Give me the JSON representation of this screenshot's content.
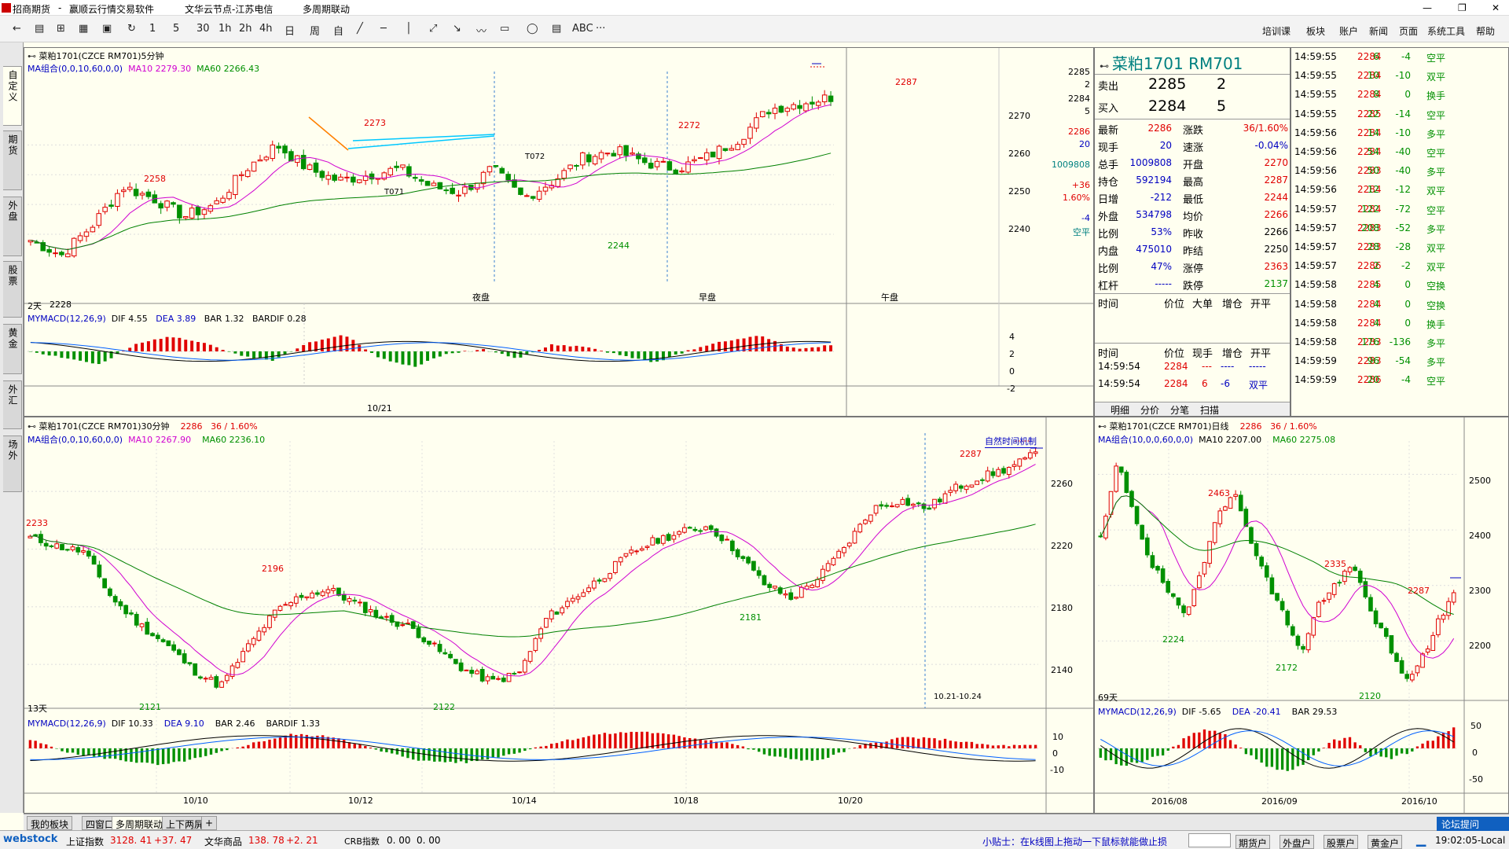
{
  "titlebar": {
    "app": "招商期货",
    "sep": "-",
    "product": "赢顺云行情交易软件",
    "server": "文华云节点-江苏电信",
    "mode": "多周期联动"
  },
  "toolbar": {
    "tools": [
      "←",
      "▤",
      "⊞",
      "▦",
      "▣",
      "↻",
      "1",
      "5",
      "30",
      "1h",
      "2h",
      "4h",
      "日",
      "周",
      "自",
      "╱",
      "─",
      "│",
      "⤢",
      "↘",
      "〰",
      "▭",
      "◯",
      "▤",
      "ABC",
      "···"
    ],
    "menus": [
      "培训课",
      "板块",
      "账户",
      "新闻",
      "页面",
      "系统工具",
      "帮助"
    ]
  },
  "left_tabs": [
    "自定义",
    "期货",
    "外盘",
    "股票",
    "黄金",
    "外汇",
    "场外"
  ],
  "chart5m": {
    "title": "菜粕1701(CZCE RM701)5分钟",
    "ma_label": "MA组合(0,0,10,60,0,0)",
    "ma10": "MA10 2279.30",
    "ma60": "MA60 2266.43",
    "macd_label": "MYMACD(12,26,9)",
    "dif": "DIF  4.55",
    "dea": "DEA  3.89",
    "bar": "BAR  1.32",
    "bardif": "BARDIF  0.28",
    "days": "2天",
    "low_label": "2228",
    "sessions": [
      "夜盘",
      "早盘",
      "午盘"
    ],
    "annotations": [
      "2273",
      "2272",
      "2258",
      "2244",
      "2287",
      "T071",
      "T072"
    ],
    "date": "10/21",
    "yticks": [
      "2270",
      "2260",
      "2250",
      "2240"
    ],
    "right_info": [
      "2285",
      "2",
      "2284",
      "5",
      "2286",
      "20",
      "1009808",
      "+36",
      "1.60%",
      "-4",
      "空平"
    ],
    "macd_ticks": [
      "4",
      "2",
      "0",
      "-2"
    ]
  },
  "quote": {
    "name": "菜粕1701  RM701",
    "sell_label": "卖出",
    "sell_price": "2285",
    "sell_vol": "2",
    "buy_label": "买入",
    "buy_price": "2284",
    "buy_vol": "5",
    "rows": [
      {
        "l": "最新",
        "v": "2286",
        "l2": "涨跌",
        "v2": "36/1.60%"
      },
      {
        "l": "现手",
        "v": "20",
        "l2": "速涨",
        "v2": "-0.04%"
      },
      {
        "l": "总手",
        "v": "1009808",
        "l2": "开盘",
        "v2": "2270"
      },
      {
        "l": "持仓",
        "v": "592194",
        "l2": "最高",
        "v2": "2287"
      },
      {
        "l": "日增",
        "v": "-212",
        "l2": "最低",
        "v2": "2244"
      },
      {
        "l": "外盘",
        "v": "534798",
        "l2": "均价",
        "v2": "2266"
      },
      {
        "l": "比例",
        "v": "53%",
        "l2": "昨收",
        "v2": "2266"
      },
      {
        "l": "内盘",
        "v": "475010",
        "l2": "昨结",
        "v2": "2250"
      },
      {
        "l": "比例",
        "v": "47%",
        "l2": "涨停",
        "v2": "2363"
      },
      {
        "l": "杠杆",
        "v": "-----",
        "l2": "跌停",
        "v2": "2137"
      }
    ],
    "tick_header": [
      "时间",
      "价位",
      "大单",
      "增仓",
      "开平"
    ],
    "tick_header2": [
      "时间",
      "价位",
      "现手",
      "增仓",
      "开平"
    ],
    "ticks_small": [
      {
        "t": "14:59:54",
        "p": "2284",
        "v": "---",
        "c": "----",
        "k": "-----"
      },
      {
        "t": "14:59:54",
        "p": "2284",
        "v": "6",
        "c": "-6",
        "k": "双平"
      }
    ],
    "tabs": [
      "明细",
      "分价",
      "分笔",
      "扫描"
    ]
  },
  "trades": [
    {
      "t": "14:59:55",
      "p": "2284",
      "v": "6",
      "c": "-4",
      "k": "空平"
    },
    {
      "t": "14:59:55",
      "p": "2284",
      "v": "10",
      "c": "-10",
      "k": "双平"
    },
    {
      "t": "14:59:55",
      "p": "2284",
      "v": "8",
      "c": "0",
      "k": "换手"
    },
    {
      "t": "14:59:55",
      "p": "2285",
      "v": "22",
      "c": "-14",
      "k": "空平"
    },
    {
      "t": "14:59:56",
      "p": "2284",
      "v": "14",
      "c": "-10",
      "k": "多平"
    },
    {
      "t": "14:59:56",
      "p": "2284",
      "v": "54",
      "c": "-40",
      "k": "空平"
    },
    {
      "t": "14:59:56",
      "p": "2283",
      "v": "50",
      "c": "-40",
      "k": "多平"
    },
    {
      "t": "14:59:56",
      "p": "2284",
      "v": "12",
      "c": "-12",
      "k": "双平"
    },
    {
      "t": "14:59:57",
      "p": "2284",
      "v": "122",
      "c": "-72",
      "k": "空平"
    },
    {
      "t": "14:59:57",
      "p": "2283",
      "v": "208",
      "c": "-52",
      "k": "多平"
    },
    {
      "t": "14:59:57",
      "p": "2283",
      "v": "28",
      "c": "-28",
      "k": "双平"
    },
    {
      "t": "14:59:57",
      "p": "2286",
      "v": "2",
      "c": "-2",
      "k": "双平"
    },
    {
      "t": "14:59:58",
      "p": "2285",
      "v": "4",
      "c": "0",
      "k": "空换"
    },
    {
      "t": "14:59:58",
      "p": "2284",
      "v": "4",
      "c": "0",
      "k": "空换"
    },
    {
      "t": "14:59:58",
      "p": "2284",
      "v": "4",
      "c": "0",
      "k": "换手"
    },
    {
      "t": "14:59:58",
      "p": "2283",
      "v": "176",
      "c": "-136",
      "k": "多平"
    },
    {
      "t": "14:59:59",
      "p": "2283",
      "v": "96",
      "c": "-54",
      "k": "多平"
    },
    {
      "t": "14:59:59",
      "p": "2286",
      "v": "20",
      "c": "-4",
      "k": "空平"
    }
  ],
  "chart30m": {
    "title": "菜粕1701(CZCE RM701)30分钟",
    "last": "2286",
    "chg": "36 / 1.60%",
    "ma_label": "MA组合(0,0,10,60,0,0)",
    "ma10": "MA10 2267.90",
    "ma60": "MA60 2236.10",
    "macd_label": "MYMACD(12,26,9)",
    "dif": "DIF  10.33",
    "dea": "DEA  9.10",
    "bar": "BAR  2.46",
    "bardif": "BARDIF  1.33",
    "days": "13天",
    "natural": "自然时间机制",
    "range": "10.21-10.24",
    "annotations": [
      "2233",
      "2196",
      "2121",
      "2122",
      "2181",
      "2287"
    ],
    "yticks": [
      "2260",
      "2220",
      "2180",
      "2140"
    ],
    "macd_ticks": [
      "10",
      "0",
      "-10"
    ],
    "dates": [
      "10/10",
      "10/12",
      "10/14",
      "10/18",
      "10/20"
    ]
  },
  "chartDay": {
    "title": "菜粕1701(CZCE RM701)日线",
    "last": "2286",
    "chg": "36 / 1.60%",
    "ma_label": "MA组合(10,0,0,60,0,0)",
    "ma10": "MA10 2207.00",
    "ma60": "MA60 2275.08",
    "macd_label": "MYMACD(12,26,9)",
    "dif": "DIF  -5.65",
    "dea": "DEA  -20.41",
    "bar": "BAR  29.53",
    "days": "69天",
    "annotations": [
      "2463",
      "2224",
      "2172",
      "2335",
      "2120",
      "2287"
    ],
    "yticks": [
      "2500",
      "2400",
      "2300",
      "2200"
    ],
    "macd_ticks": [
      "50",
      "0",
      "-50"
    ],
    "dates": [
      "2016/08",
      "2016/09",
      "2016/10"
    ]
  },
  "bottom_tabs": [
    "我的板块",
    "四窗口",
    "多周期联动",
    "上下两屏",
    "+"
  ],
  "statusbar": {
    "logo": "webstock",
    "sh_label": "上证指数",
    "sh_val": "3128. 41",
    "sh_chg": "+37. 47",
    "wh_label": "文华商品",
    "wh_val": "138. 78",
    "wh_chg": "+2. 21",
    "crb_label": "CRB指数",
    "crb_val": "0. 00",
    "crb_chg": "0. 00",
    "tip": "小贴士：在k线图上拖动一下鼠标就能做止损",
    "btns": [
      "期货户",
      "外盘户",
      "股票户",
      "黄金户"
    ],
    "forum": "论坛提问",
    "clock": "19:02:05-Local"
  },
  "colors": {
    "up": "#e00000",
    "down": "#009000",
    "ma10": "#d000d0",
    "ma60": "#008000",
    "bg": "#fffff0",
    "macd_dif": "#000000",
    "macd_dea": "#0060ff"
  }
}
